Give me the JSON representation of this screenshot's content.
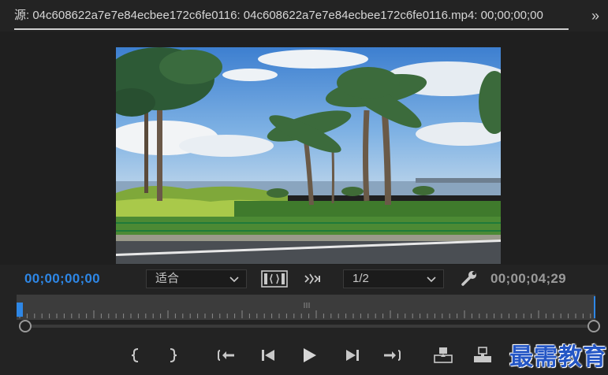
{
  "panel": {
    "tab_title": "源: 04c608622a7e7e84ecbee172c6fe0116: 04c608622a7e7e84ecbee172c6fe0116.mp4: 00;00;00;00",
    "overflow_icon": "double-chevron-right-icon"
  },
  "controls": {
    "current_timecode": "00;00;00;00",
    "duration_timecode": "00;00;04;29",
    "zoom_select": "适合",
    "resolution_select": "1/2",
    "icons": [
      "drag-video-only-icon",
      "drag-audio-only-icon",
      "settings-wrench-icon"
    ]
  },
  "transport": {
    "icons": [
      "mark-in-icon",
      "mark-out-icon",
      "go-to-in-icon",
      "step-back-icon",
      "play-icon",
      "step-forward-icon",
      "go-to-out-icon",
      "insert-icon",
      "overwrite-icon"
    ]
  },
  "colors": {
    "accent": "#2e87e6",
    "background": "#232323"
  },
  "watermark": "最需教育"
}
